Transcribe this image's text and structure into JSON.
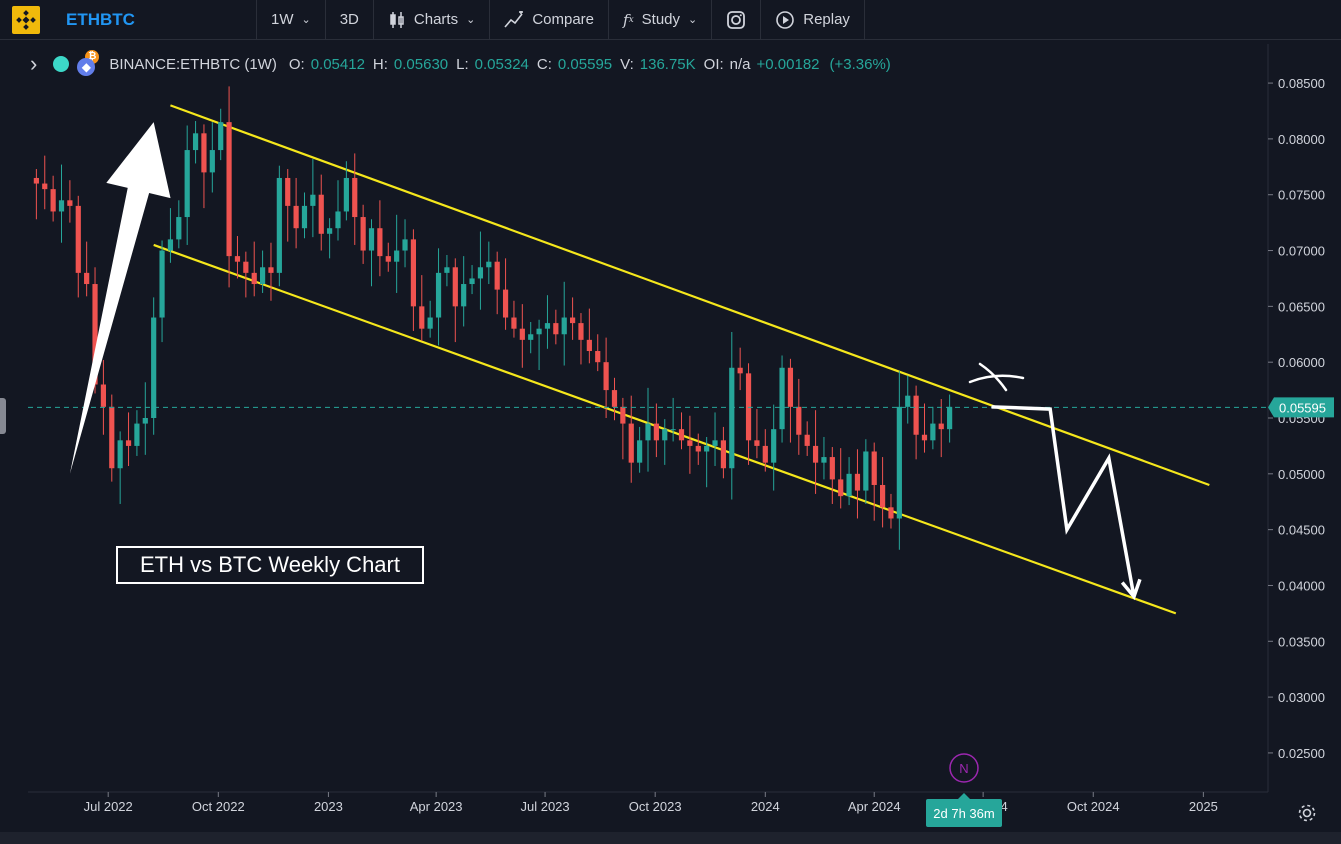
{
  "toolbar": {
    "symbol": "ETHBTC",
    "interval": "1W",
    "view3d": "3D",
    "charts": "Charts",
    "compare": "Compare",
    "study": "Study",
    "replay": "Replay"
  },
  "legend": {
    "title": "BINANCE:ETHBTC (1W)",
    "o_label": "O:",
    "o": "0.05412",
    "h_label": "H:",
    "h": "0.05630",
    "l_label": "L:",
    "l": "0.05324",
    "c_label": "C:",
    "c": "0.05595",
    "v_label": "V:",
    "v": "136.75K",
    "oi_label": "OI:",
    "oi": "n/a",
    "change": "+0.00182",
    "change_pct": "(+3.36%)"
  },
  "colors": {
    "background": "#131722",
    "up": "#26a69a",
    "down": "#ef5350",
    "channel": "#f5e71c",
    "annotation": "#ffffff",
    "axis_text": "#d1d4dc",
    "time_badge": "#26a69a",
    "news_marker": "#9c27b0"
  },
  "annotation_text": "ETH vs BTC Weekly Chart",
  "news_marker": "N",
  "time_badge": "2d 7h 36m",
  "last_price_label": "0.05595",
  "chart_data": {
    "type": "candlestick",
    "interval": "1W",
    "y_ticks": [
      "0.08500",
      "0.08000",
      "0.07500",
      "0.07000",
      "0.06500",
      "0.06000",
      "0.05500",
      "0.05000",
      "0.04500",
      "0.04000",
      "0.03500",
      "0.03000",
      "0.02500"
    ],
    "x_ticks": [
      "Jul 2022",
      "Oct 2022",
      "2023",
      "Apr 2023",
      "Jul 2023",
      "Oct 2023",
      "2024",
      "Apr 2024",
      "Jul 2024",
      "Oct 2024",
      "2025"
    ],
    "ylim": [
      0.0215,
      0.0885
    ],
    "xlim": [
      "2022-04-25",
      "2025-02-24"
    ],
    "last_price": 0.05595,
    "closes": [
      0.076,
      0.0755,
      0.0735,
      0.0745,
      0.074,
      0.068,
      0.067,
      0.058,
      0.056,
      0.0505,
      0.053,
      0.0525,
      0.0545,
      0.055,
      0.064,
      0.07,
      0.071,
      0.073,
      0.079,
      0.0805,
      0.077,
      0.079,
      0.0815,
      0.0695,
      0.069,
      0.068,
      0.067,
      0.0685,
      0.068,
      0.0765,
      0.074,
      0.072,
      0.074,
      0.075,
      0.0715,
      0.072,
      0.0735,
      0.0765,
      0.073,
      0.07,
      0.072,
      0.0695,
      0.069,
      0.07,
      0.071,
      0.065,
      0.063,
      0.064,
      0.068,
      0.0685,
      0.065,
      0.067,
      0.0675,
      0.0685,
      0.069,
      0.0665,
      0.064,
      0.063,
      0.062,
      0.0625,
      0.063,
      0.0635,
      0.0625,
      0.064,
      0.0635,
      0.062,
      0.061,
      0.06,
      0.0575,
      0.056,
      0.0545,
      0.051,
      0.053,
      0.0545,
      0.053,
      0.054,
      0.054,
      0.053,
      0.0525,
      0.052,
      0.0525,
      0.053,
      0.0505,
      0.0595,
      0.059,
      0.053,
      0.0525,
      0.051,
      0.054,
      0.0595,
      0.056,
      0.0535,
      0.0525,
      0.051,
      0.0515,
      0.0495,
      0.048,
      0.05,
      0.0485,
      0.052,
      0.049,
      0.047,
      0.046,
      0.056,
      0.057,
      0.0535,
      0.053,
      0.0545,
      0.054,
      0.056
    ],
    "channel_upper": {
      "from": [
        "2022-08-22",
        0.083
      ],
      "to": [
        "2025-01-06",
        0.049
      ]
    },
    "channel_lower": {
      "from": [
        "2022-08-08",
        0.0705
      ],
      "to": [
        "2024-12-09",
        0.0375
      ]
    },
    "projection": [
      [
        "2024-07-08",
        0.056
      ],
      [
        "2024-08-26",
        0.0558
      ],
      [
        "2024-09-09",
        0.045
      ],
      [
        "2024-10-14",
        0.0514
      ],
      [
        "2024-11-04",
        0.039
      ]
    ],
    "rally_arrow": {
      "from": [
        "2022-05-30",
        0.05
      ],
      "to": [
        "2022-08-08",
        0.0815
      ]
    }
  }
}
